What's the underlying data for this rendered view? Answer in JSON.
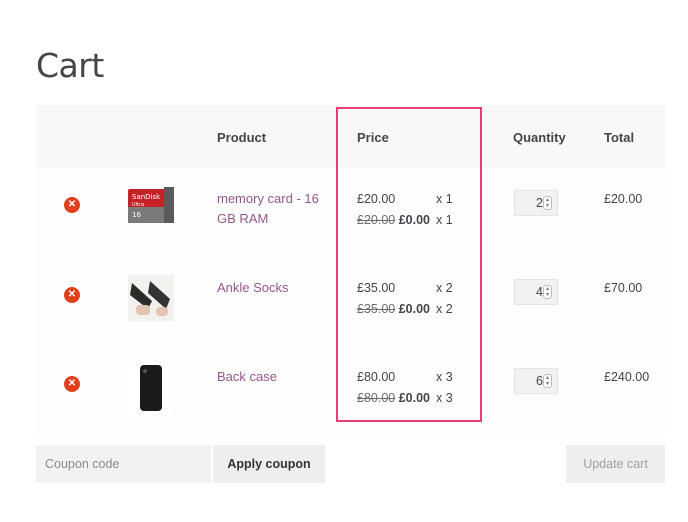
{
  "page": {
    "title": "Cart"
  },
  "table": {
    "headers": {
      "product": "Product",
      "price": "Price",
      "quantity": "Quantity",
      "total": "Total"
    }
  },
  "items": [
    {
      "name": "memory card - 16 GB RAM",
      "image": "sd-card-image",
      "price": "£20.00",
      "price_qty": "x 1",
      "orig_price": "£20.00",
      "sale_price": "£0.00",
      "sale_qty": "x 1",
      "quantity": "2",
      "total": "£20.00"
    },
    {
      "name": "Ankle Socks",
      "image": "socks-image",
      "price": "£35.00",
      "price_qty": "x 2",
      "orig_price": "£35.00",
      "sale_price": "£0.00",
      "sale_qty": "x 2",
      "quantity": "4",
      "total": "£70.00"
    },
    {
      "name": "Back case",
      "image": "phone-case-image",
      "price": "£80.00",
      "price_qty": "x 3",
      "orig_price": "£80.00",
      "sale_price": "£0.00",
      "sale_qty": "x 3",
      "quantity": "6",
      "total": "£240.00"
    }
  ],
  "actions": {
    "coupon_placeholder": "Coupon code",
    "apply_label": "Apply coupon",
    "update_label": "Update cart"
  },
  "colors": {
    "accent_link": "#96588a",
    "remove": "#e2401c",
    "highlight": "#e83e74"
  }
}
